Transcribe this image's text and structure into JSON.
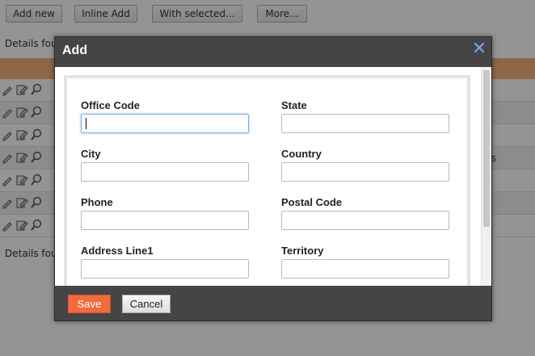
{
  "toolbar": {
    "add_new": "Add new",
    "inline_add": "Inline Add",
    "with_selected": "With selected...",
    "more": "More..."
  },
  "grid": {
    "details_top": "Details four",
    "details_bottom": "Details four",
    "row_right_text": "s",
    "row_icons": [
      "edit-icon",
      "copy-icon",
      "view-icon"
    ],
    "header_color": "#f7b27a"
  },
  "dialog": {
    "title": "Add",
    "close_symbol": "✕",
    "close_color": "#7aa7e0",
    "fields": {
      "office_code": {
        "label": "Office Code",
        "value": ""
      },
      "state": {
        "label": "State",
        "value": ""
      },
      "city": {
        "label": "City",
        "value": ""
      },
      "country": {
        "label": "Country",
        "value": ""
      },
      "phone": {
        "label": "Phone",
        "value": ""
      },
      "postal_code": {
        "label": "Postal Code",
        "value": ""
      },
      "address_line1": {
        "label": "Address Line1",
        "value": ""
      },
      "territory": {
        "label": "Territory",
        "value": ""
      }
    },
    "save_label": "Save",
    "cancel_label": "Cancel",
    "save_color": "#f26b3e"
  }
}
